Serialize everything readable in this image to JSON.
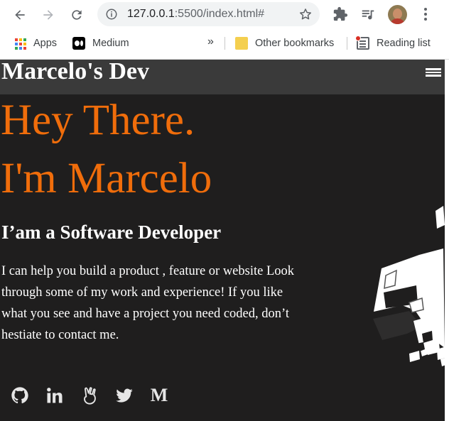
{
  "browser": {
    "url_host": "127.0.0.1",
    "url_rest": ":5500/index.html#",
    "bookmarks": [
      {
        "label": "Apps",
        "icon": "apps-grid-icon"
      },
      {
        "label": "Medium",
        "icon": "medium-icon"
      },
      {
        "label": "Other bookmarks",
        "icon": "folder-icon"
      },
      {
        "label": "Reading list",
        "icon": "reading-list-icon"
      }
    ],
    "overflow": "»"
  },
  "site": {
    "brand": "Marcelo's Dev",
    "hero_line1": "Hey There.",
    "hero_line2": "I'm Marcelo",
    "role": "I’am a Software Developer",
    "description": "I can help you build a product , feature or website Look through some of my work and experience! If you like what you see and have a project you need coded, don’t hestiate to contact me.",
    "socials": [
      {
        "name": "github",
        "icon": "github-icon"
      },
      {
        "name": "linkedin",
        "icon": "linkedin-icon",
        "label": "in"
      },
      {
        "name": "angellist",
        "icon": "angellist-icon"
      },
      {
        "name": "twitter",
        "icon": "twitter-icon"
      },
      {
        "name": "medium",
        "icon": "medium-icon",
        "label": "M"
      }
    ]
  },
  "colors": {
    "background": "#1f1e1e",
    "header": "#3a3a3a",
    "accent": "#f06d0b",
    "text": "#ffffff"
  }
}
